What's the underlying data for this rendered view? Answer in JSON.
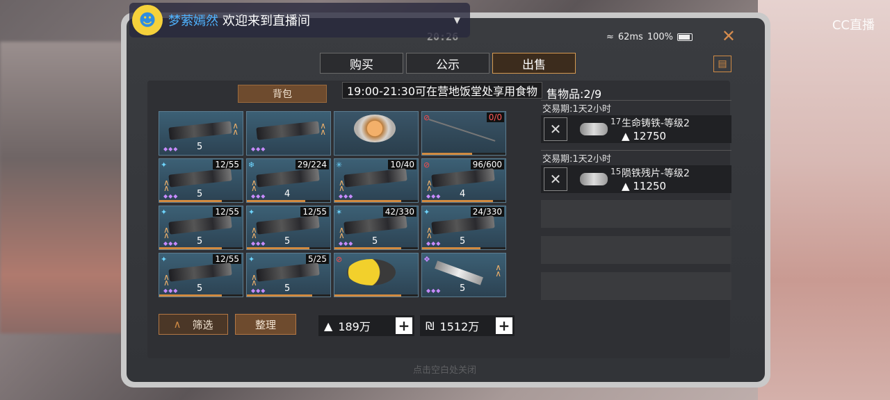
{
  "stream": {
    "streamer_name": "梦萦嫣然",
    "welcome_text": "欢迎来到直播间",
    "watermark": "CC直播"
  },
  "status_bar": {
    "clock": "20:26",
    "ping": "62ms",
    "battery": "100%"
  },
  "tabs": [
    {
      "label": "购买",
      "active": false
    },
    {
      "label": "公示",
      "active": false
    },
    {
      "label": "出售",
      "active": true
    }
  ],
  "backpack_label": "背包",
  "tooltip_text": "19:00-21:30可在营地饭堂处享用食物",
  "sell_count_text": "售物品:2/9",
  "inventory": [
    {
      "type": "weapon",
      "level": "5",
      "ammo": ""
    },
    {
      "type": "weapon",
      "level": "",
      "ammo": ""
    },
    {
      "type": "food",
      "level": "",
      "ammo": ""
    },
    {
      "type": "rod",
      "level": "",
      "ammo": "0/0"
    },
    {
      "type": "weapon",
      "level": "5",
      "ammo": "12/55"
    },
    {
      "type": "weapon",
      "level": "4",
      "ammo": "29/224"
    },
    {
      "type": "weapon",
      "level": "",
      "ammo": "10/40"
    },
    {
      "type": "weapon",
      "level": "4",
      "ammo": "96/600"
    },
    {
      "type": "weapon",
      "level": "5",
      "ammo": "12/55"
    },
    {
      "type": "weapon",
      "level": "5",
      "ammo": "12/55"
    },
    {
      "type": "weapon",
      "level": "5",
      "ammo": "42/330"
    },
    {
      "type": "weapon",
      "level": "5",
      "ammo": "24/330"
    },
    {
      "type": "weapon",
      "level": "5",
      "ammo": "12/55"
    },
    {
      "type": "weapon",
      "level": "5",
      "ammo": "5/25"
    },
    {
      "type": "vacuum",
      "level": "",
      "ammo": ""
    },
    {
      "type": "blade",
      "level": "5",
      "ammo": ""
    }
  ],
  "buttons": {
    "filter": "筛选",
    "sort": "整理"
  },
  "currency": {
    "silver": "189万",
    "gold": "1512万"
  },
  "trades": [
    {
      "period": "交易期:1天2小时",
      "qty": "17",
      "name": "生命铸铁-等级2",
      "price": "12750"
    },
    {
      "period": "交易期:1天2小时",
      "qty": "15",
      "name": "陨铁残片-等级2",
      "price": "11250"
    }
  ],
  "footer_hint": "点击空白处关闭"
}
